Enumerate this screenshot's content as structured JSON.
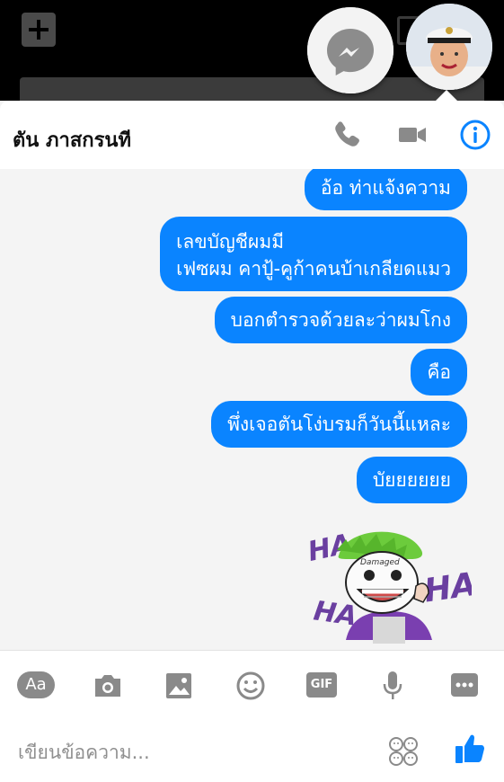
{
  "contact": {
    "name": "ตัน ภาสกรนที"
  },
  "messages": [
    {
      "text": "อ้อ ท่าแจ้งความ"
    },
    {
      "text": "เลขบัญชีผมมี\nเฟซผม คาปู้-คูก้าคนบ้าเกลียดแมว"
    },
    {
      "text": "บอกตำรวจด้วยละว่าผมโกง"
    },
    {
      "text": "คือ"
    },
    {
      "text": "พึ่งเจอตันโง่บรมก็วันนี้แหละ"
    },
    {
      "text": "บัยยยยยย"
    }
  ],
  "sticker": {
    "label_top": "Damaged",
    "laugh_text": "HA"
  },
  "toolbar": {
    "aa_label": "Aa",
    "gif_label": "GIF"
  },
  "composer": {
    "placeholder": "เขียนข้อความ..."
  },
  "colors": {
    "bubble": "#0a84ff",
    "icon_gray": "#8a8a8a",
    "accent": "#0a84ff"
  },
  "icons": [
    "plus-icon",
    "messenger-icon",
    "phone-icon",
    "video-icon",
    "info-icon",
    "camera-icon",
    "image-icon",
    "emoji-icon",
    "gif-icon",
    "microphone-icon",
    "more-icon",
    "sticker-icon",
    "like-icon"
  ]
}
